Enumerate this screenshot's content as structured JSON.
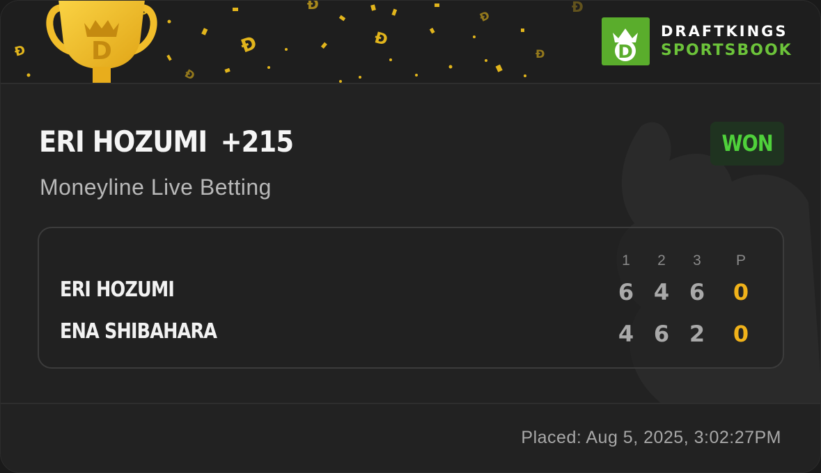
{
  "brand": {
    "line1": "DRAFTKINGS",
    "line2": "SPORTSBOOK",
    "logo_color": "#5aad2c"
  },
  "bet": {
    "selection": "ERI HOZUMI",
    "odds": "+215",
    "market": "Moneyline Live Betting",
    "status": "WON",
    "status_color": "#4fd13b"
  },
  "scoreboard": {
    "columns": [
      "1",
      "2",
      "3",
      "P"
    ],
    "rows": [
      {
        "player": "ERI HOZUMI",
        "scores": [
          "6",
          "4",
          "6",
          "0"
        ]
      },
      {
        "player": "ENA SHIBAHARA",
        "scores": [
          "4",
          "6",
          "2",
          "0"
        ]
      }
    ]
  },
  "placed": "Placed: Aug 5, 2025, 3:02:27PM",
  "icons": [
    "trophy-icon",
    "draftkings-logo-icon",
    "confetti",
    "watermark-crown-icon"
  ]
}
